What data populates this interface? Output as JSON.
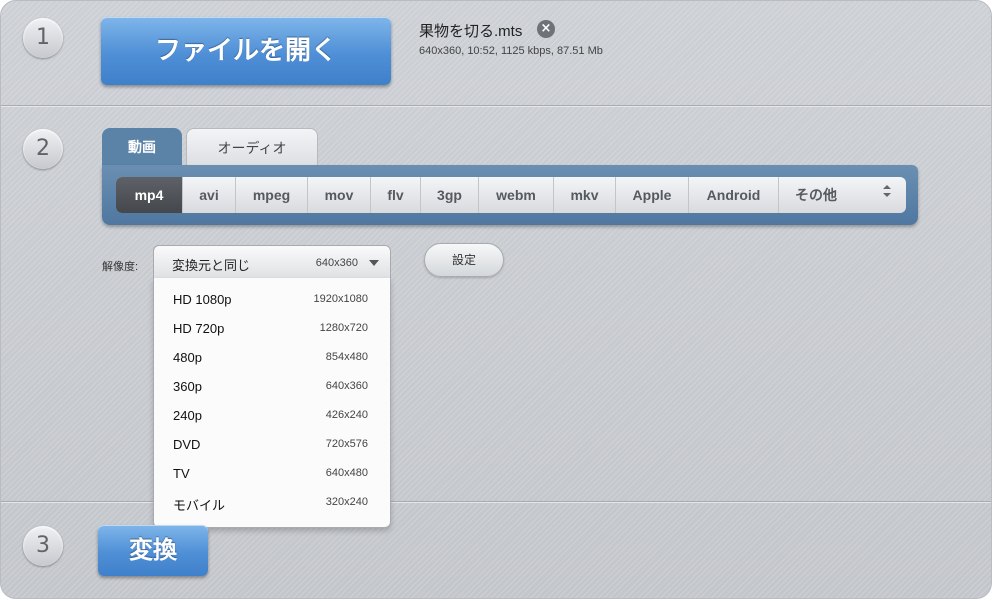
{
  "steps": {
    "one": "1",
    "two": "2",
    "three": "3"
  },
  "open_file": {
    "label": "ファイルを開く"
  },
  "file": {
    "name": "果物を切る.mts",
    "meta": "640x360, 10:52, 1125 kbps, 87.51 Mb",
    "close_icon": "×"
  },
  "tabs": [
    {
      "label": "動画",
      "active": true
    },
    {
      "label": "オーディオ",
      "active": false
    }
  ],
  "formats": [
    {
      "label": "mp4",
      "active": true
    },
    {
      "label": "avi"
    },
    {
      "label": "mpeg"
    },
    {
      "label": "mov"
    },
    {
      "label": "flv"
    },
    {
      "label": "3gp"
    },
    {
      "label": "webm"
    },
    {
      "label": "mkv"
    },
    {
      "label": "Apple"
    },
    {
      "label": "Android"
    },
    {
      "label": "その他"
    }
  ],
  "resolution": {
    "label": "解像度:",
    "selected_name": "変換元と同じ",
    "selected_value": "640x360",
    "options": [
      {
        "name": "HD 1080p",
        "res": "1920x1080"
      },
      {
        "name": "HD 720p",
        "res": "1280x720"
      },
      {
        "name": "480p",
        "res": "854x480"
      },
      {
        "name": "360p",
        "res": "640x360"
      },
      {
        "name": "240p",
        "res": "426x240"
      },
      {
        "name": "DVD",
        "res": "720x576"
      },
      {
        "name": "TV",
        "res": "640x480"
      },
      {
        "name": "モバイル",
        "res": "320x240"
      }
    ]
  },
  "settings": {
    "label": "設定"
  },
  "convert": {
    "label": "変換"
  },
  "colors": {
    "accent_blue": "#4f8fd6",
    "tab_bar": "#5b83a8",
    "background": "#c8cbd0"
  }
}
